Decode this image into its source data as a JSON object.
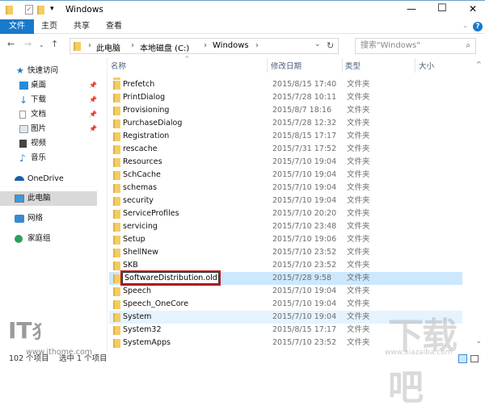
{
  "window": {
    "title": "Windows",
    "minimize": "—",
    "maximize": "☐",
    "close": "✕"
  },
  "ribbon": {
    "tabs": [
      "文件",
      "主页",
      "共享",
      "查看"
    ],
    "help": "?"
  },
  "address": {
    "crumbs": [
      "此电脑",
      "本地磁盘 (C:)",
      "Windows"
    ],
    "search_placeholder": "搜索\"Windows\""
  },
  "sidebar": {
    "items": [
      {
        "label": "快速访问",
        "icon": "star-icon"
      },
      {
        "label": "桌面",
        "icon": "desktop-icon",
        "pinned": true
      },
      {
        "label": "下载",
        "icon": "download-icon",
        "pinned": true
      },
      {
        "label": "文档",
        "icon": "document-icon",
        "pinned": true
      },
      {
        "label": "图片",
        "icon": "picture-icon",
        "pinned": true
      },
      {
        "label": "视频",
        "icon": "video-icon"
      },
      {
        "label": "音乐",
        "icon": "music-icon"
      },
      {
        "label": "OneDrive",
        "icon": "cloud-icon"
      },
      {
        "label": "此电脑",
        "icon": "computer-icon",
        "selected": true
      },
      {
        "label": "网络",
        "icon": "network-icon"
      },
      {
        "label": "家庭组",
        "icon": "homegroup-icon"
      }
    ]
  },
  "columns": {
    "name": "名称",
    "date": "修改日期",
    "type": "类型",
    "size": "大小"
  },
  "files": [
    {
      "name": "Prefetch",
      "date": "2015/8/15 17:40",
      "type": "文件夹"
    },
    {
      "name": "PrintDialog",
      "date": "2015/7/28 10:11",
      "type": "文件夹"
    },
    {
      "name": "Provisioning",
      "date": "2015/8/7 18:16",
      "type": "文件夹"
    },
    {
      "name": "PurchaseDialog",
      "date": "2015/7/28 12:32",
      "type": "文件夹"
    },
    {
      "name": "Registration",
      "date": "2015/8/15 17:17",
      "type": "文件夹"
    },
    {
      "name": "rescache",
      "date": "2015/7/31 17:52",
      "type": "文件夹"
    },
    {
      "name": "Resources",
      "date": "2015/7/10 19:04",
      "type": "文件夹"
    },
    {
      "name": "SchCache",
      "date": "2015/7/10 19:04",
      "type": "文件夹"
    },
    {
      "name": "schemas",
      "date": "2015/7/10 19:04",
      "type": "文件夹"
    },
    {
      "name": "security",
      "date": "2015/7/10 19:04",
      "type": "文件夹"
    },
    {
      "name": "ServiceProfiles",
      "date": "2015/7/10 20:20",
      "type": "文件夹"
    },
    {
      "name": "servicing",
      "date": "2015/7/10 23:48",
      "type": "文件夹"
    },
    {
      "name": "Setup",
      "date": "2015/7/10 19:06",
      "type": "文件夹"
    },
    {
      "name": "ShellNew",
      "date": "2015/7/10 23:52",
      "type": "文件夹"
    },
    {
      "name": "SKB",
      "date": "2015/7/10 23:52",
      "type": "文件夹"
    },
    {
      "name": "SoftwareDistribution.old",
      "date": "2015/7/28 9:58",
      "type": "文件夹",
      "state": "renaming"
    },
    {
      "name": "Speech",
      "date": "2015/7/10 19:04",
      "type": "文件夹"
    },
    {
      "name": "Speech_OneCore",
      "date": "2015/7/10 19:04",
      "type": "文件夹"
    },
    {
      "name": "System",
      "date": "2015/7/10 19:04",
      "type": "文件夹",
      "state": "hover"
    },
    {
      "name": "System32",
      "date": "2015/8/15 17:17",
      "type": "文件夹"
    },
    {
      "name": "SystemApps",
      "date": "2015/7/10 23:52",
      "type": "文件夹"
    }
  ],
  "status": {
    "count": "102 个项目",
    "selected": "选中 1 个项目"
  },
  "watermarks": {
    "ithome": "www.ithome.com",
    "ithome_logo": "IT之家",
    "xiazaiba": "下载吧",
    "xiazaiba_url": "www.xiazaiba.com"
  },
  "colors": {
    "accent": "#1979ca",
    "selection": "#cce8ff",
    "rename_border": "#c4161c"
  }
}
